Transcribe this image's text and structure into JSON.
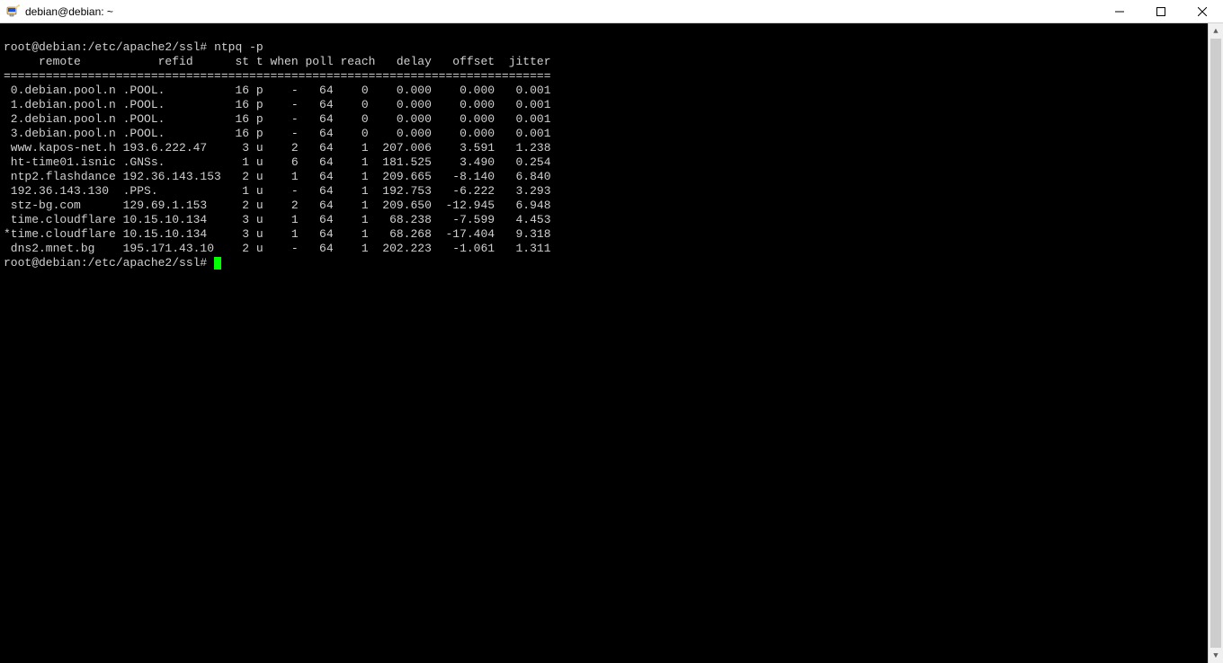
{
  "window": {
    "title": "debian@debian: ~"
  },
  "terminal": {
    "prompt1": "root@debian:/etc/apache2/ssl#",
    "command": "ntpq -p",
    "header": "     remote           refid      st t when poll reach   delay   offset  jitter",
    "separator": "==============================================================================",
    "rows": [
      " 0.debian.pool.n .POOL.          16 p    -   64    0    0.000    0.000   0.001",
      " 1.debian.pool.n .POOL.          16 p    -   64    0    0.000    0.000   0.001",
      " 2.debian.pool.n .POOL.          16 p    -   64    0    0.000    0.000   0.001",
      " 3.debian.pool.n .POOL.          16 p    -   64    0    0.000    0.000   0.001",
      " www.kapos-net.h 193.6.222.47     3 u    2   64    1  207.006    3.591   1.238",
      " ht-time01.isnic .GNSs.           1 u    6   64    1  181.525    3.490   0.254",
      " ntp2.flashdance 192.36.143.153   2 u    1   64    1  209.665   -8.140   6.840",
      " 192.36.143.130  .PPS.            1 u    -   64    1  192.753   -6.222   3.293",
      " stz-bg.com      129.69.1.153     2 u    2   64    1  209.650  -12.945   6.948",
      " time.cloudflare 10.15.10.134     3 u    1   64    1   68.238   -7.599   4.453",
      "*time.cloudflare 10.15.10.134     3 u    1   64    1   68.268  -17.404   9.318",
      " dns2.mnet.bg    195.171.43.10    2 u    -   64    1  202.223   -1.061   1.311"
    ],
    "prompt2": "root@debian:/etc/apache2/ssl#"
  },
  "chart_data": {
    "type": "table",
    "title": "ntpq -p",
    "columns": [
      "remote",
      "refid",
      "st",
      "t",
      "when",
      "poll",
      "reach",
      "delay",
      "offset",
      "jitter"
    ],
    "rows": [
      {
        "remote": "0.debian.pool.n",
        "refid": ".POOL.",
        "st": 16,
        "t": "p",
        "when": "-",
        "poll": 64,
        "reach": 0,
        "delay": 0.0,
        "offset": 0.0,
        "jitter": 0.001,
        "tally": " "
      },
      {
        "remote": "1.debian.pool.n",
        "refid": ".POOL.",
        "st": 16,
        "t": "p",
        "when": "-",
        "poll": 64,
        "reach": 0,
        "delay": 0.0,
        "offset": 0.0,
        "jitter": 0.001,
        "tally": " "
      },
      {
        "remote": "2.debian.pool.n",
        "refid": ".POOL.",
        "st": 16,
        "t": "p",
        "when": "-",
        "poll": 64,
        "reach": 0,
        "delay": 0.0,
        "offset": 0.0,
        "jitter": 0.001,
        "tally": " "
      },
      {
        "remote": "3.debian.pool.n",
        "refid": ".POOL.",
        "st": 16,
        "t": "p",
        "when": "-",
        "poll": 64,
        "reach": 0,
        "delay": 0.0,
        "offset": 0.0,
        "jitter": 0.001,
        "tally": " "
      },
      {
        "remote": "www.kapos-net.h",
        "refid": "193.6.222.47",
        "st": 3,
        "t": "u",
        "when": 2,
        "poll": 64,
        "reach": 1,
        "delay": 207.006,
        "offset": 3.591,
        "jitter": 1.238,
        "tally": " "
      },
      {
        "remote": "ht-time01.isnic",
        "refid": ".GNSs.",
        "st": 1,
        "t": "u",
        "when": 6,
        "poll": 64,
        "reach": 1,
        "delay": 181.525,
        "offset": 3.49,
        "jitter": 0.254,
        "tally": " "
      },
      {
        "remote": "ntp2.flashdance",
        "refid": "192.36.143.153",
        "st": 2,
        "t": "u",
        "when": 1,
        "poll": 64,
        "reach": 1,
        "delay": 209.665,
        "offset": -8.14,
        "jitter": 6.84,
        "tally": " "
      },
      {
        "remote": "192.36.143.130",
        "refid": ".PPS.",
        "st": 1,
        "t": "u",
        "when": "-",
        "poll": 64,
        "reach": 1,
        "delay": 192.753,
        "offset": -6.222,
        "jitter": 3.293,
        "tally": " "
      },
      {
        "remote": "stz-bg.com",
        "refid": "129.69.1.153",
        "st": 2,
        "t": "u",
        "when": 2,
        "poll": 64,
        "reach": 1,
        "delay": 209.65,
        "offset": -12.945,
        "jitter": 6.948,
        "tally": " "
      },
      {
        "remote": "time.cloudflare",
        "refid": "10.15.10.134",
        "st": 3,
        "t": "u",
        "when": 1,
        "poll": 64,
        "reach": 1,
        "delay": 68.238,
        "offset": -7.599,
        "jitter": 4.453,
        "tally": " "
      },
      {
        "remote": "time.cloudflare",
        "refid": "10.15.10.134",
        "st": 3,
        "t": "u",
        "when": 1,
        "poll": 64,
        "reach": 1,
        "delay": 68.268,
        "offset": -17.404,
        "jitter": 9.318,
        "tally": "*"
      },
      {
        "remote": "dns2.mnet.bg",
        "refid": "195.171.43.10",
        "st": 2,
        "t": "u",
        "when": "-",
        "poll": 64,
        "reach": 1,
        "delay": 202.223,
        "offset": -1.061,
        "jitter": 1.311,
        "tally": " "
      }
    ]
  }
}
